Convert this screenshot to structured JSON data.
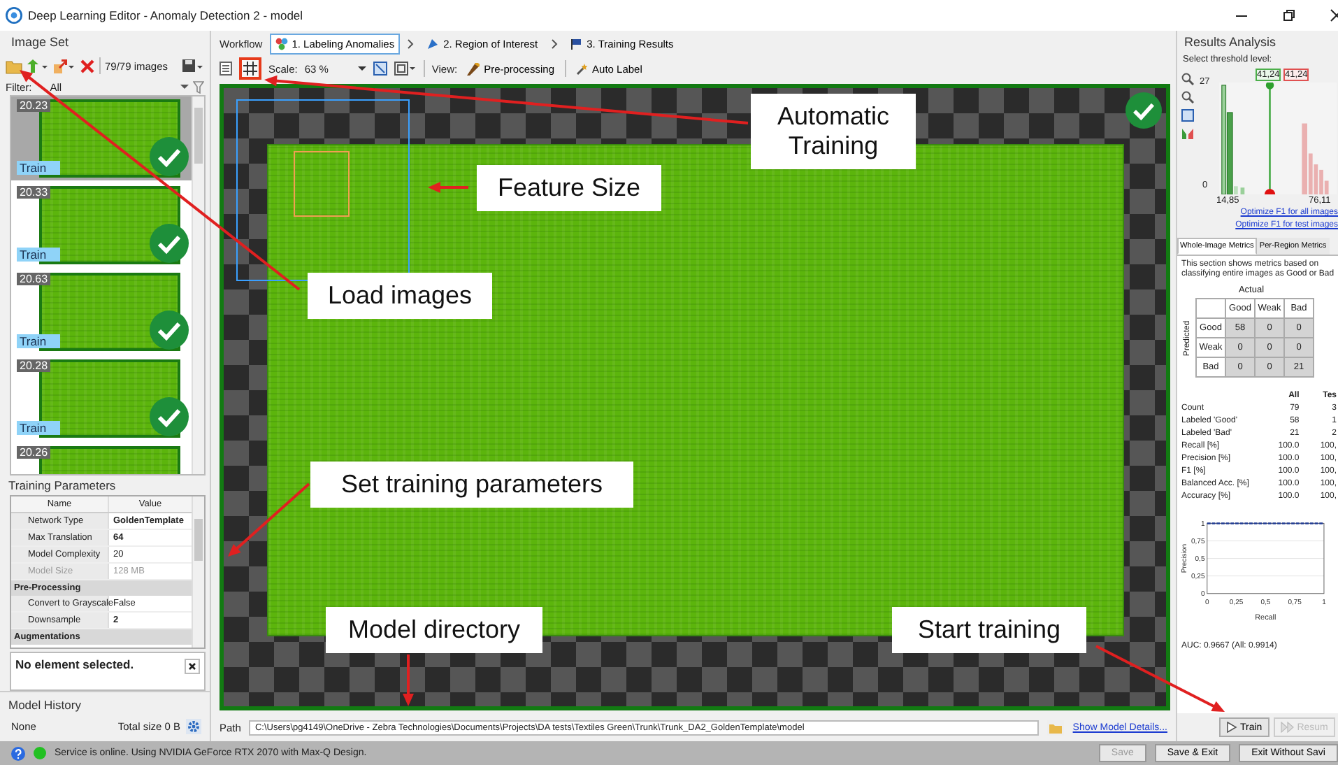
{
  "window": {
    "title": "Deep Learning Editor - Anomaly Detection 2 - model"
  },
  "image_set": {
    "title": "Image Set",
    "count": "79/79 images",
    "filter_label": "Filter:",
    "filter_value": "All",
    "images": [
      {
        "label": "20.23",
        "tag": "Train",
        "checked": true,
        "selected": true
      },
      {
        "label": "20.33",
        "tag": "Train",
        "checked": true,
        "selected": false
      },
      {
        "label": "20.63",
        "tag": "Train",
        "checked": true,
        "selected": false
      },
      {
        "label": "20.28",
        "tag": "Train",
        "checked": true,
        "selected": false
      },
      {
        "label": "20.26",
        "selected": false
      }
    ]
  },
  "training_parameters": {
    "title": "Training Parameters",
    "columns": [
      "Name",
      "Value"
    ],
    "rows": [
      {
        "kind": "property",
        "name": "Network Type",
        "value": "GoldenTemplate",
        "modified": true,
        "disabled": false
      },
      {
        "kind": "property",
        "name": "Max Translation",
        "value": "64",
        "modified": true,
        "disabled": false
      },
      {
        "kind": "property",
        "name": "Model Complexity",
        "value": "20",
        "modified": false,
        "disabled": false
      },
      {
        "kind": "property",
        "name": "Model Size",
        "value": "128 MB",
        "modified": false,
        "disabled": true
      },
      {
        "kind": "category",
        "name": "Pre-Processing"
      },
      {
        "kind": "property",
        "name": "Convert to Grayscale",
        "value": "False",
        "modified": false,
        "disabled": false
      },
      {
        "kind": "property",
        "name": "Downsample",
        "value": "2",
        "modified": true,
        "disabled": false
      },
      {
        "kind": "category",
        "name": "Augmentations"
      }
    ],
    "description": "No element selected."
  },
  "model_history": {
    "title": "Model History",
    "entry": "None",
    "total_size": "Total size 0 B"
  },
  "workflow": {
    "title": "Workflow",
    "steps": [
      {
        "label": "1. Labeling Anomalies",
        "selected": true
      },
      {
        "label": "2. Region of Interest",
        "selected": false
      },
      {
        "label": "3. Training Results",
        "selected": false
      }
    ]
  },
  "toolbar": {
    "scale_label": "Scale:",
    "scale_value": "63 %",
    "view_label": "View:",
    "preprocessing": "Pre-processing",
    "auto_label": "Auto Label"
  },
  "canvas": {
    "checked": true
  },
  "callouts": [
    {
      "text": "Automatic Training"
    },
    {
      "text": "Feature Size"
    },
    {
      "text": "Load images"
    },
    {
      "text": "Set training parameters"
    },
    {
      "text": "Model directory"
    },
    {
      "text": "Start training"
    }
  ],
  "path": {
    "label": "Path",
    "value": "C:\\Users\\pg4149\\OneDrive - Zebra Technologies\\Documents\\Projects\\DA tests\\Textiles Green\\Trunk\\Trunk_DA2_GoldenTemplate\\model",
    "details_link": "Show Model Details..."
  },
  "training_buttons": [
    {
      "kind": "train",
      "label": "Train",
      "disabled": false
    },
    {
      "kind": "resume",
      "label": "Resum",
      "disabled": true
    }
  ],
  "results": {
    "title": "Results Analysis",
    "threshold_label": "Select threshold level:",
    "histogram": {
      "y_max": "27",
      "y_min": "0",
      "x_min": "14,85",
      "x_max": "76,11",
      "threshold_low": "41,24",
      "threshold_high": "41,24"
    },
    "links": [
      "Optimize F1 for all images",
      "Optimize F1 for test images"
    ],
    "tabs": [
      {
        "label": "Whole-Image Metrics",
        "selected": true
      },
      {
        "label": "Per-Region Metrics",
        "selected": false
      }
    ],
    "description": "This section shows metrics based on classifying entire images as Good or Bad",
    "confusion": {
      "actual_label": "Actual",
      "predicted_label": "Predicted",
      "columns": [
        "Good",
        "Weak",
        "Bad"
      ],
      "rows": [
        {
          "label": "Good",
          "cells": [
            "58",
            "0",
            "0"
          ]
        },
        {
          "label": "Weak",
          "cells": [
            "0",
            "0",
            "0"
          ]
        },
        {
          "label": "Bad",
          "cells": [
            "0",
            "0",
            "21"
          ]
        }
      ]
    },
    "metrics": {
      "columns": [
        "All",
        "Tes"
      ],
      "rows": [
        {
          "name": "Count",
          "values": [
            "79",
            "3"
          ]
        },
        {
          "name": "Labeled 'Good'",
          "values": [
            "58",
            "1"
          ]
        },
        {
          "name": "Labeled 'Bad'",
          "values": [
            "21",
            "2"
          ]
        },
        {
          "name": "Recall [%]",
          "values": [
            "100.0",
            "100,"
          ]
        },
        {
          "name": "Precision [%]",
          "values": [
            "100.0",
            "100,"
          ]
        },
        {
          "name": "F1 [%]",
          "values": [
            "100.0",
            "100,"
          ]
        },
        {
          "name": "Balanced Acc. [%]",
          "values": [
            "100.0",
            "100,"
          ]
        },
        {
          "name": "Accuracy [%]",
          "values": [
            "100.0",
            "100,"
          ]
        }
      ]
    },
    "pr_chart": {
      "chart_data": {
        "type": "line",
        "xlabel": "Recall",
        "ylabel": "Precision",
        "x": [
          0,
          1
        ],
        "series": [
          {
            "color": "#1f3a93",
            "line_style": "dashed",
            "values": [
              1,
              1
            ]
          }
        ],
        "grid": true,
        "xlim": [
          0,
          1
        ],
        "ylim": [
          0,
          1
        ],
        "xticks": [
          0,
          {
            "value": 0.25,
            "label": "0,25"
          },
          {
            "value": 0.5,
            "label": "0,5"
          },
          {
            "value": 0.75,
            "label": "0,75"
          },
          1
        ],
        "yticks": [
          0,
          {
            "value": 0.25,
            "label": "0,25"
          },
          {
            "value": 0.5,
            "label": "0,5"
          },
          {
            "value": 0.75,
            "label": "0,75"
          },
          1
        ]
      }
    },
    "auc": "AUC: 0.9667 (All: 0.9914)"
  },
  "status_bar": {
    "message": "Service is online. Using NVIDIA GeForce RTX 2070 with Max-Q Design.",
    "online": true,
    "buttons": [
      {
        "label": "Save",
        "disabled": true
      },
      {
        "label": "Save & Exit",
        "disabled": false
      },
      {
        "label": "Exit Without Savi",
        "disabled": false
      }
    ]
  }
}
